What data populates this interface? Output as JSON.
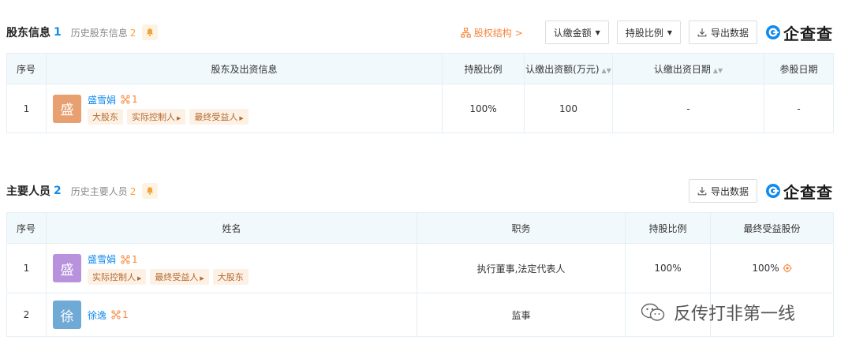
{
  "shareholders": {
    "title": "股东信息",
    "count": "1",
    "history_label": "历史股东信息",
    "history_count": "2",
    "structure_link": "股权结构 >",
    "btn_amount": "认缴金额",
    "btn_ratio": "持股比例",
    "btn_export": "导出数据",
    "brand": "企查查",
    "columns": [
      "序号",
      "股东及出资信息",
      "持股比例",
      "认缴出资额(万元)",
      "认缴出资日期",
      "参股日期"
    ],
    "rows": [
      {
        "index": "1",
        "avatar_char": "盛",
        "name": "盛雪娟",
        "relation_count": "1",
        "tags": [
          "大股东",
          "实际控制人",
          "最终受益人"
        ],
        "ratio": "100%",
        "amount": "100",
        "date": "-",
        "join_date": "-"
      }
    ]
  },
  "personnel": {
    "title": "主要人员",
    "count": "2",
    "history_label": "历史主要人员",
    "history_count": "2",
    "btn_export": "导出数据",
    "brand": "企查查",
    "columns": [
      "序号",
      "姓名",
      "职务",
      "持股比例",
      "最终受益股份"
    ],
    "rows": [
      {
        "index": "1",
        "avatar_char": "盛",
        "name": "盛雪娟",
        "relation_count": "1",
        "tags": [
          "实际控制人",
          "最终受益人",
          "大股东"
        ],
        "position": "执行董事,法定代表人",
        "ratio": "100%",
        "benefit": "100%"
      },
      {
        "index": "2",
        "avatar_char": "徐",
        "name": "徐逸",
        "relation_count": "1",
        "tags": [],
        "position": "监事",
        "ratio": "",
        "benefit": ""
      }
    ]
  },
  "watermark": "反传打非第一线",
  "colors": {
    "accent_blue": "#128bed",
    "accent_orange": "#f6853b",
    "avatar_orange": "#e8a070",
    "avatar_purple": "#b892dc",
    "avatar_blue": "#6fa9d6",
    "header_bg": "#f2f9fc"
  }
}
